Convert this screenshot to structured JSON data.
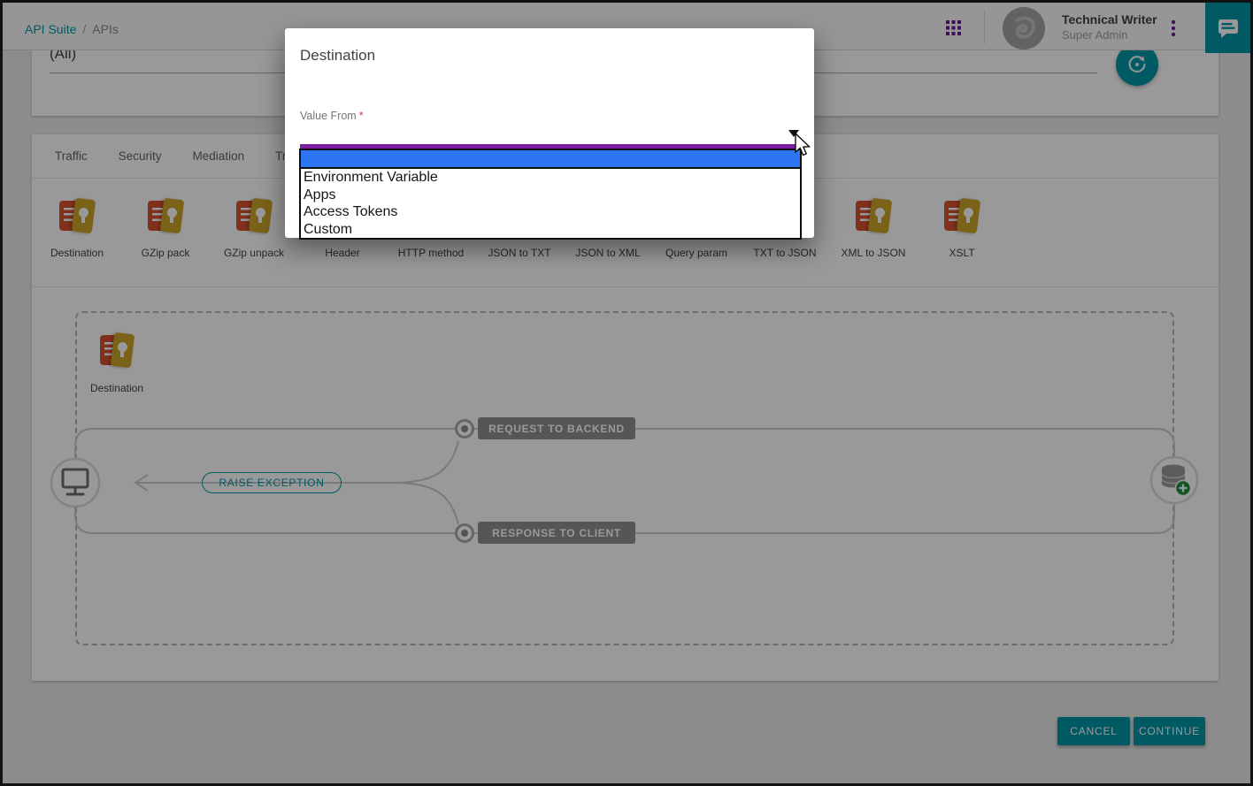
{
  "topbar": {
    "breadcrumb": [
      "API Suite",
      "APIs"
    ],
    "breadcrumb_separator": "/",
    "user_name": "Technical Writer",
    "user_role": "Super Admin"
  },
  "filter": {
    "value": "(All)"
  },
  "tabs": [
    "Traffic",
    "Security",
    "Mediation",
    "Tra"
  ],
  "policies": [
    "Destination",
    "GZip pack",
    "GZip unpack",
    "Header",
    "HTTP method",
    "JSON to TXT",
    "JSON to XML",
    "Query param",
    "TXT to JSON",
    "XML to JSON",
    "XSLT"
  ],
  "canvas": {
    "node_label": "Destination",
    "request_pill": "REQUEST TO BACKEND",
    "response_pill": "RESPONSE TO CLIENT",
    "exception_pill": "RAISE EXCEPTION"
  },
  "footer": {
    "cancel": "CANCEL",
    "continue": "CONTINUE"
  },
  "modal": {
    "title": "Destination",
    "field_label": "Value From",
    "required_mark": "*",
    "selected_value": "",
    "options": [
      "Environment Variable",
      "Apps",
      "Access Tokens",
      "Custom"
    ]
  },
  "colors": {
    "brand_teal": "#0097A7",
    "highlight_blue": "#2E75F2",
    "focus_purple": "#7b1fa2",
    "icon_red": "#D8502F",
    "icon_yellow": "#CDA42B",
    "badge_green": "#1E8E3E"
  }
}
